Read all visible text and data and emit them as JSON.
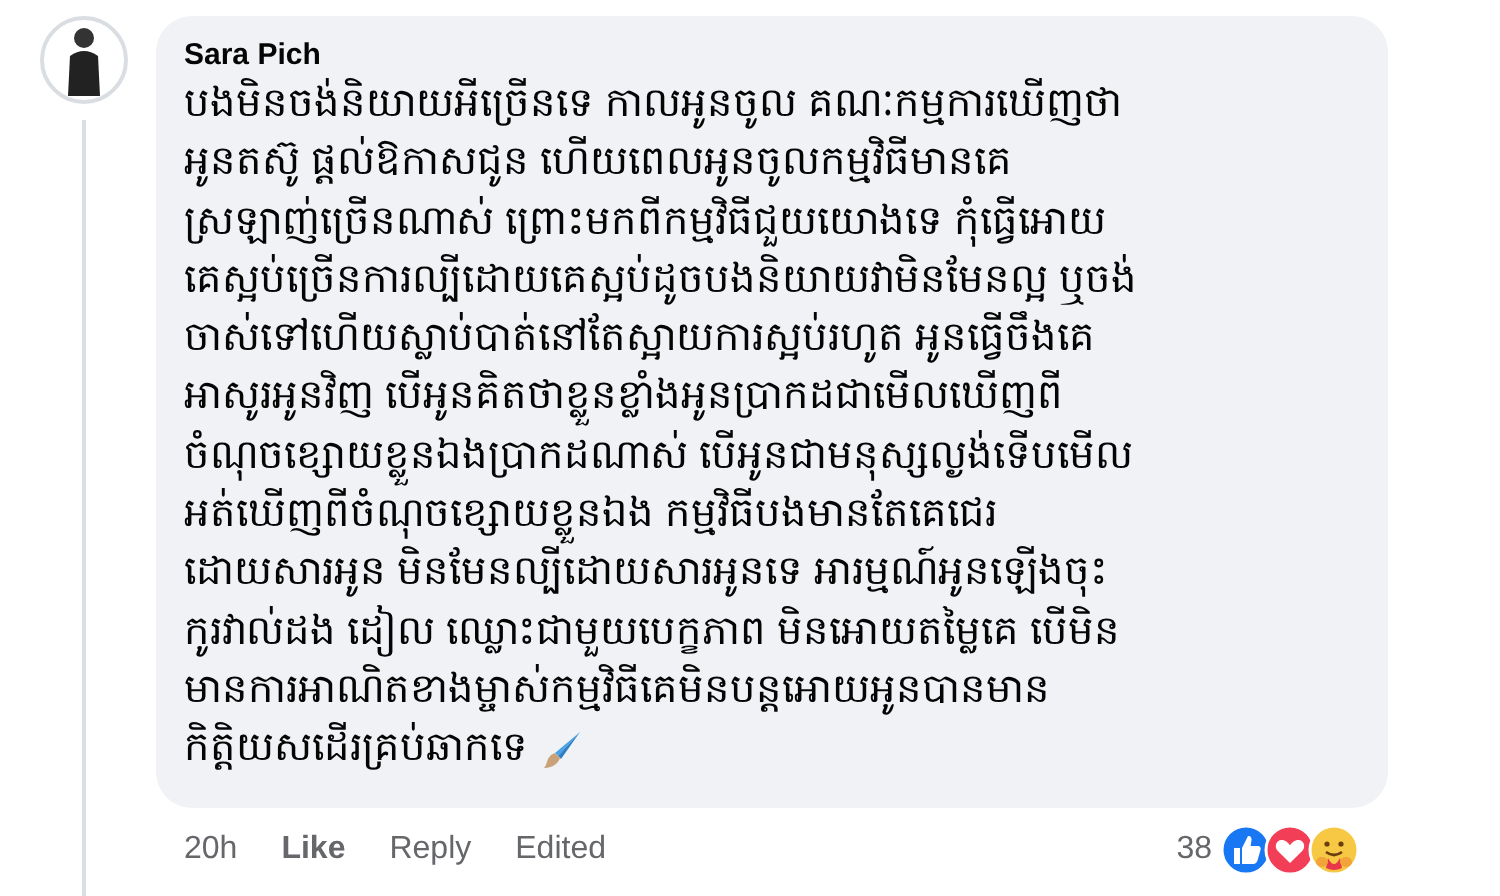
{
  "comment": {
    "author": "Sara Pich",
    "lines": [
      "បងមិនចង់និយាយអីច្រើនទេ កាលអូនចូល គណៈកម្មការឃើញថា",
      "អូនតស៊ូ ផ្តល់ឱកាសជូន ហើយពេលអូនចូលកម្មវិធីមានគេ",
      "ស្រឡាញ់ច្រើនណាស់ ព្រោះមកពីកម្មវិធីជួយយោងទេ កុំធ្វើអោយ",
      "គេស្អប់ច្រើនការល្បីដោយគេស្អប់ដូចបងនិយាយវាមិនមែនល្អ ឬចង់",
      "ចាស់ទៅហើយស្លាប់បាត់នៅតែស្អាយការស្អប់រហូត អូនធ្វើចឹងគេ",
      "អាសូរអូនវិញ បើអូនគិតថាខ្លួនខ្លាំងអូនប្រាកដជាមើលឃើញពី",
      "ចំណុចខ្សោយខ្លួនឯងប្រាកដណាស់ បើអូនជាមនុស្សល្ងង់ទើបមើល",
      "អត់ឃើញពីចំណុចខ្សោយខ្លួនឯង កម្មវិធីបងមានតែគេជេរ",
      "ដោយសារអូន មិនមែនល្បីដោយសារអូនទេ អារម្មណ៍អូនឡើងចុះ",
      "កូរវាល់ដង ដៀល ឈ្លោះជាមួយបេក្ខភាព មិនអោយតម្លៃគេ បើមិន",
      "មានការអាណិតខាងម្ចាស់កម្មវិធីគេមិនបន្តអោយអូនបានមាន",
      "កិត្តិយសដើរគ្រប់ឆាកទេ"
    ],
    "time": "20h",
    "like": "Like",
    "reply": "Reply",
    "edited": "Edited",
    "reaction_count": "38"
  }
}
